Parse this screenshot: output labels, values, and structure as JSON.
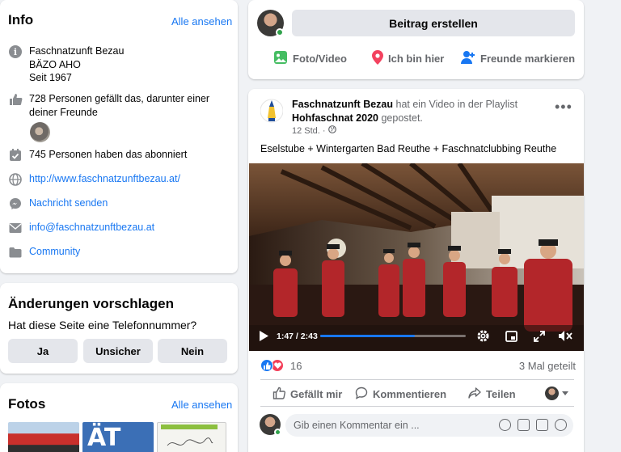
{
  "info": {
    "title": "Info",
    "see_all": "Alle ansehen",
    "about_line1": "Faschnatzunft Bezau",
    "about_line2": "BÄZO AHO",
    "about_line3": "Seit 1967",
    "likes_text": "728 Personen gefällt das, darunter einer deiner Freunde",
    "followers_text": "745 Personen haben das abonniert",
    "website": "http://www.faschnatzunftbezau.at/",
    "message": "Nachricht senden",
    "email": "info@faschnatzunftbezau.at",
    "category": "Community"
  },
  "suggest": {
    "title": "Änderungen vorschlagen",
    "question": "Hat diese Seite eine Telefonnummer?",
    "btn_yes": "Ja",
    "btn_unsure": "Unsicher",
    "btn_no": "Nein"
  },
  "photos": {
    "title": "Fotos",
    "see_all": "Alle ansehen",
    "thumb2_text": "ÄT"
  },
  "composer": {
    "create_post": "Beitrag erstellen",
    "photo_video": "Foto/Video",
    "checkin": "Ich bin hier",
    "tag_friends": "Freunde markieren"
  },
  "post": {
    "page_name": "Faschnatzunft Bezau",
    "action_text": "hat ein Video in der Playlist",
    "playlist": "Hohfaschnat 2020",
    "posted": "gepostet.",
    "time": "12 Std. ·",
    "text": "Eselstube + Wintergarten Bad Reuthe + Faschnatclubbing Reuthe",
    "video_time": "1:47 / 2:43",
    "video_progress": 0.65,
    "reaction_count": "16",
    "shares": "3 Mal geteilt",
    "like": "Gefällt mir",
    "comment": "Kommentieren",
    "share": "Teilen",
    "comment_placeholder": "Gib einen Kommentar ein ..."
  },
  "colors": {
    "accent": "#1877f2",
    "button_bg": "#e4e6eb",
    "background": "#f0f2f5",
    "online": "#31a24c"
  }
}
